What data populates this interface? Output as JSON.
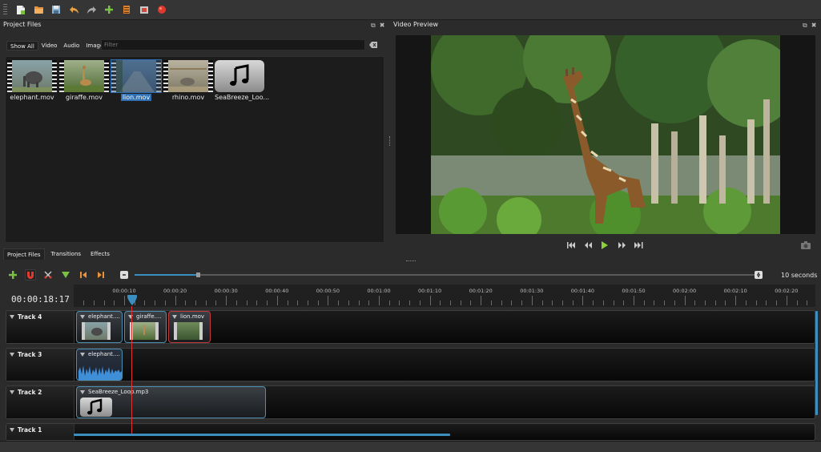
{
  "toolbar": {
    "icons": [
      "new-project-icon",
      "open-project-icon",
      "save-project-icon",
      "undo-icon",
      "redo-icon",
      "import-files-icon",
      "profile-icon",
      "export-icon",
      "record-icon"
    ]
  },
  "project_files": {
    "title": "Project Files",
    "filters": [
      "Show All",
      "Video",
      "Audio",
      "Image"
    ],
    "filter_placeholder": "Filter",
    "files": [
      {
        "name": "elephant.mov",
        "selected": false
      },
      {
        "name": "giraffe.mov",
        "selected": false
      },
      {
        "name": "lion.mov",
        "selected": true
      },
      {
        "name": "rhino.mov",
        "selected": false
      },
      {
        "name": "SeaBreeze_Loo...",
        "selected": false
      }
    ],
    "tabs": [
      "Project Files",
      "Transitions",
      "Effects"
    ]
  },
  "video_preview": {
    "title": "Video Preview"
  },
  "timeline": {
    "timecode": "00:00:18:17",
    "zoom_label": "10 seconds",
    "ruler": [
      "00:00:10",
      "00:00:20",
      "00:00:30",
      "00:00:40",
      "00:00:50",
      "00:01:00",
      "00:01:10",
      "00:01:20",
      "00:01:30",
      "00:01:40",
      "00:01:50",
      "00:02:00",
      "00:02:10",
      "00:02:20"
    ],
    "tracks": [
      {
        "name": "Track 4",
        "clips": [
          "elephant....",
          "giraffe....",
          "lion.mov"
        ]
      },
      {
        "name": "Track 3",
        "clips": [
          "elephant...."
        ]
      },
      {
        "name": "Track 2",
        "clips": [
          "SeaBreeze_Loop.mp3"
        ]
      },
      {
        "name": "Track 1",
        "clips": []
      }
    ]
  },
  "colors": {
    "accent": "#3a8fbf",
    "playhead": "#e03333",
    "selection": "#2f6fb3"
  }
}
